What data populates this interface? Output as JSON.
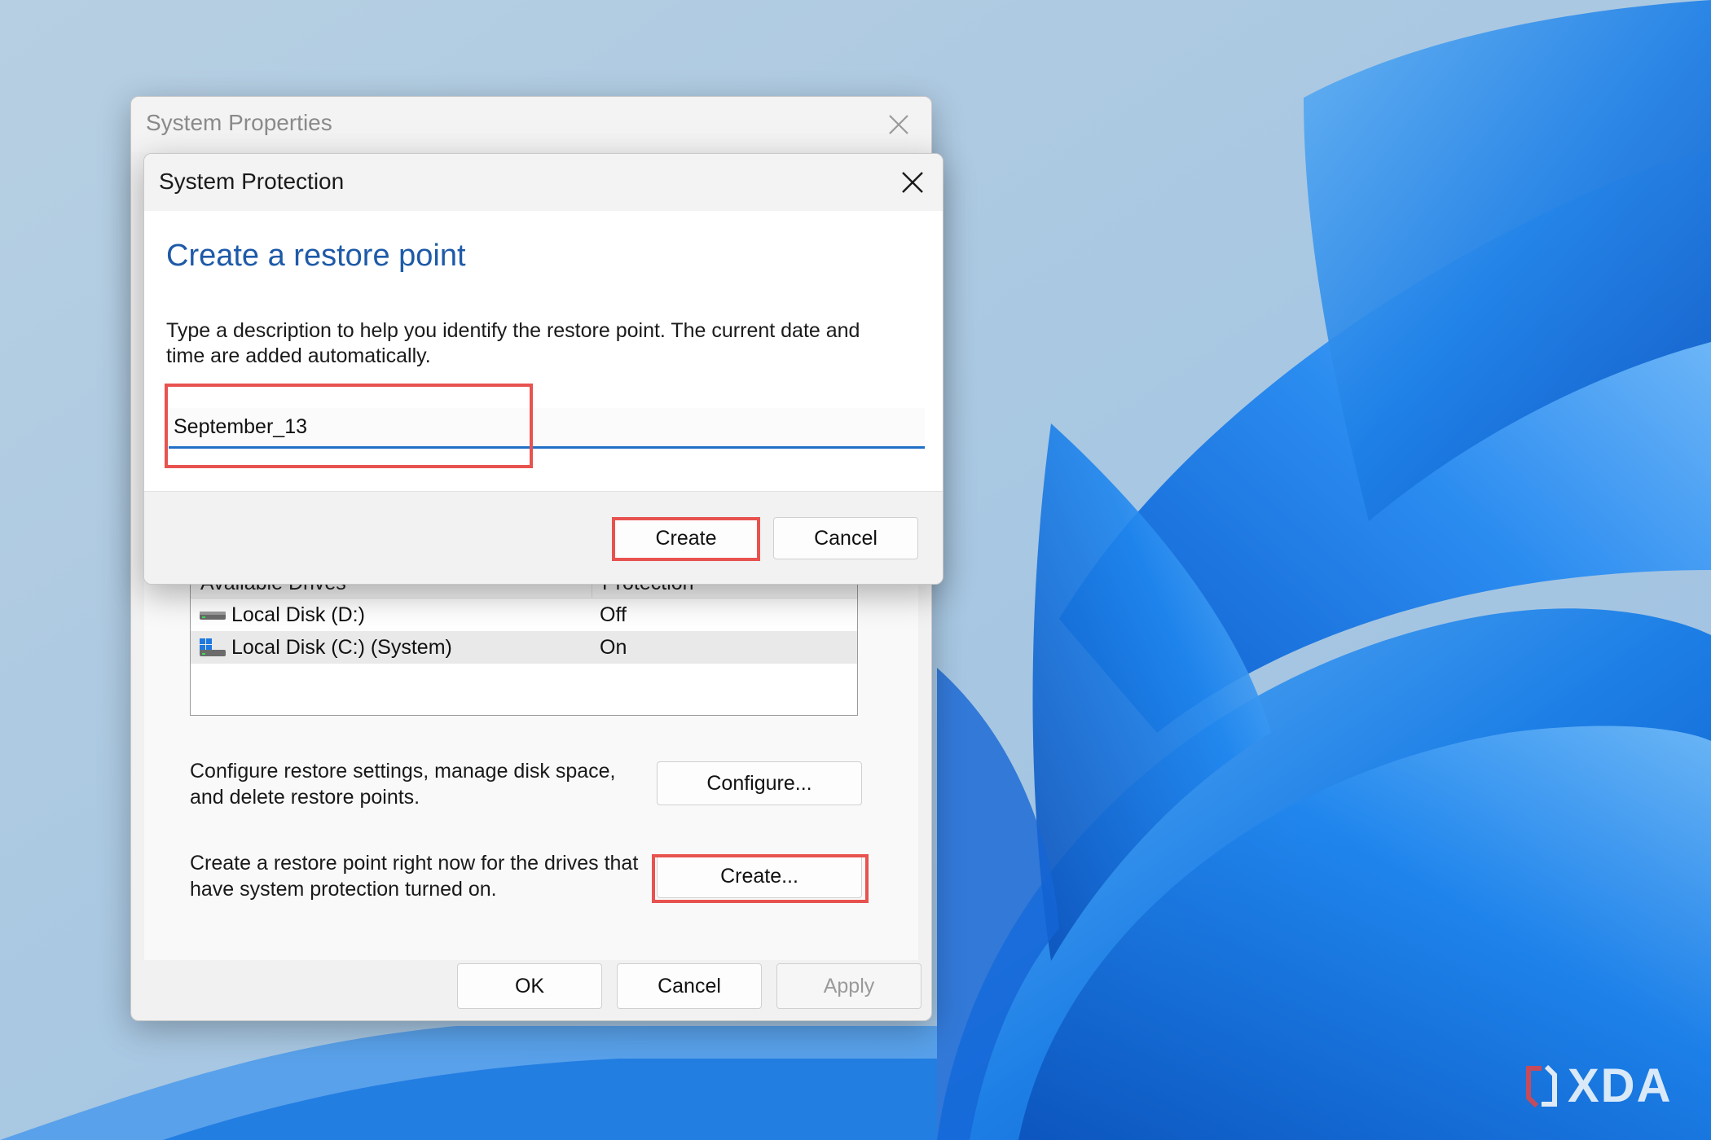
{
  "wallpaper": {
    "accent": "#1a7fe0",
    "sky": "#a9c8e0"
  },
  "system_properties": {
    "title": "System Properties",
    "drives_table": {
      "headers": [
        "Available Drives",
        "Protection"
      ],
      "rows": [
        {
          "name": "Local Disk (D:)",
          "protection": "Off"
        },
        {
          "name": "Local Disk (C:) (System)",
          "protection": "On"
        }
      ]
    },
    "configure_desc": [
      "Configure restore settings, manage disk space,",
      "and delete restore points."
    ],
    "configure_label": "Configure...",
    "create_desc": [
      "Create a restore point right now for the drives that",
      "have system protection turned on."
    ],
    "create_label": "Create...",
    "ok_label": "OK",
    "cancel_label": "Cancel",
    "apply_label": "Apply"
  },
  "system_protection": {
    "title": "System Protection",
    "heading": "Create a restore point",
    "instructions": "Type a description to help you identify the restore point. The current date and time are added automatically.",
    "name_value": "September_13",
    "create_label": "Create",
    "cancel_label": "Cancel"
  },
  "colors": {
    "highlight": "#e8524f",
    "heading": "#1e5aa8",
    "input_underline": "#1f6fc7"
  },
  "logo": {
    "text": "XDA"
  }
}
